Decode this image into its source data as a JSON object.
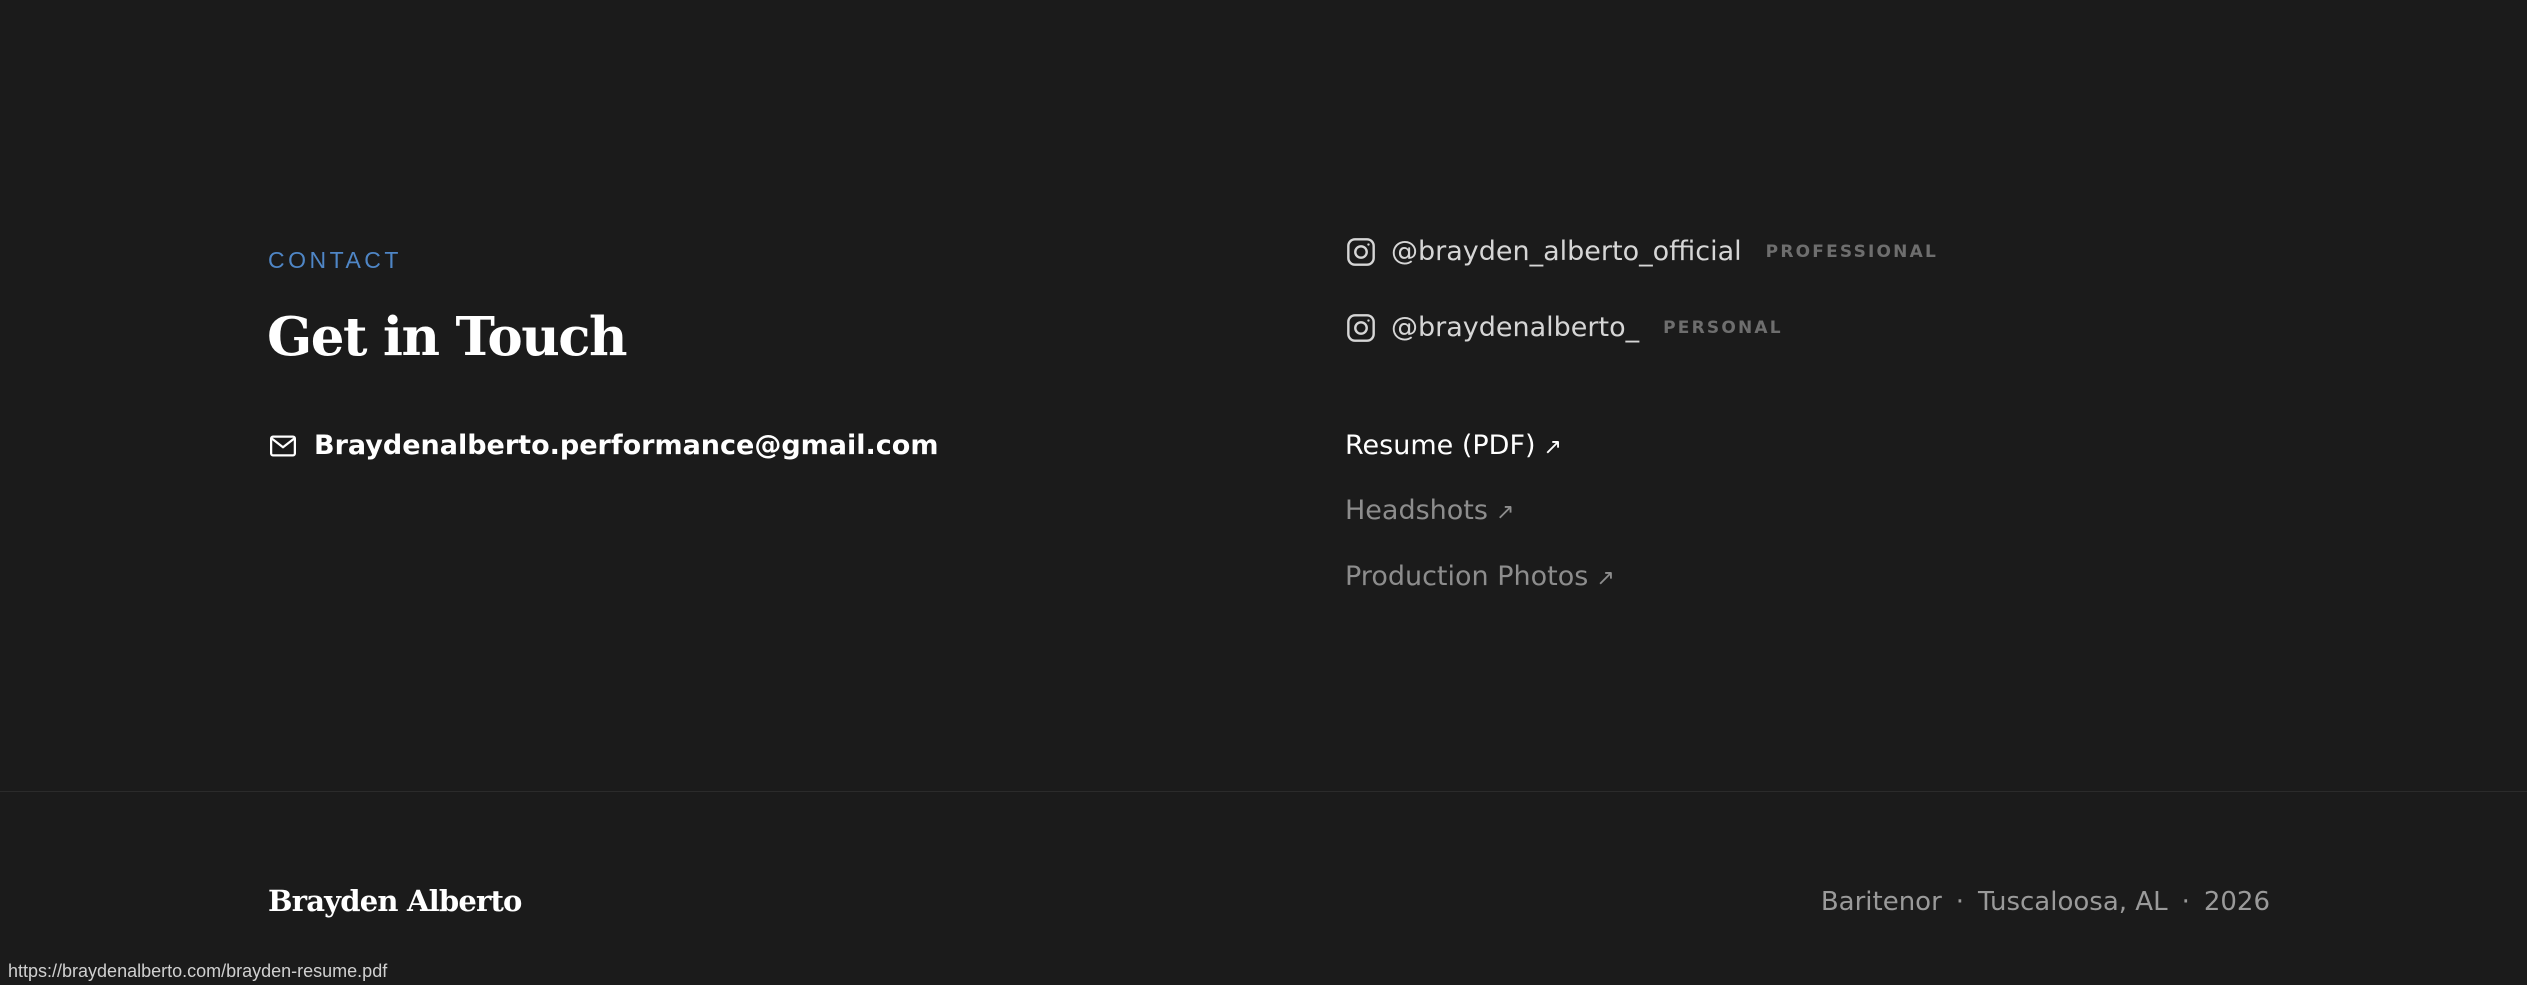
{
  "contact": {
    "eyebrow": "CONTACT",
    "title": "Get in Touch",
    "email": "Braydenalberto.performance@gmail.com",
    "email_icon": "mail-icon"
  },
  "socials": [
    {
      "handle": "@brayden_alberto_official",
      "tag": "PROFESSIONAL",
      "icon": "instagram-icon"
    },
    {
      "handle": "@braydenalberto_",
      "tag": "PERSONAL",
      "icon": "instagram-icon"
    }
  ],
  "links": [
    {
      "label": "Resume (PDF)",
      "arrow": "↗"
    },
    {
      "label": "Headshots",
      "arrow": "↗"
    },
    {
      "label": "Production Photos",
      "arrow": "↗"
    }
  ],
  "footer": {
    "name": "Brayden Alberto",
    "voice": "Baritenor",
    "location": "Tuscaloosa, AL",
    "year": "2026",
    "separator": "·"
  },
  "status_bar": {
    "url": "https://braydenalberto.com/brayden-resume.pdf"
  },
  "colors": {
    "background": "#1b1b1b",
    "accent": "#4f86c6",
    "primary_text": "#ffffff",
    "muted_text": "#8d8d8d",
    "tag_text": "#6e6e6e"
  }
}
